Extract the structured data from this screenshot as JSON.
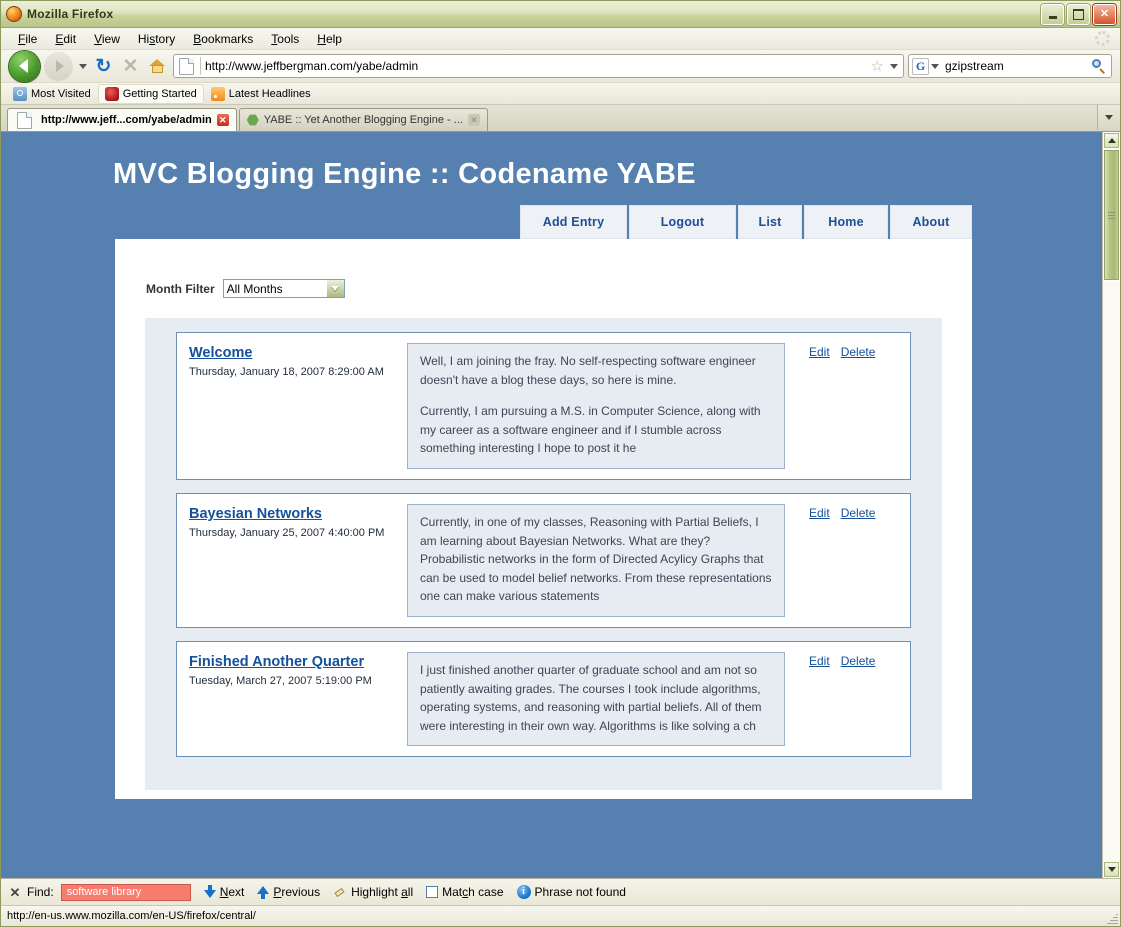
{
  "window": {
    "title": "Mozilla Firefox",
    "minimize_label": "Minimize",
    "maximize_label": "Maximize",
    "close_label": "Close"
  },
  "menubar": {
    "items": [
      "File",
      "Edit",
      "View",
      "History",
      "Bookmarks",
      "Tools",
      "Help"
    ]
  },
  "toolbar": {
    "back_label": "Back",
    "forward_label": "Forward",
    "reload_glyph": "⟳",
    "stop_glyph": "✕",
    "home_label": "Home",
    "url": "http://www.jeffbergman.com/yabe/admin",
    "star_glyph": "☆",
    "search_engine": "G",
    "search_value": "gzipstream",
    "search_placeholder": "Search"
  },
  "bookmarks": {
    "items": [
      {
        "label": "Most Visited",
        "icon": "most-visited-icon"
      },
      {
        "label": "Getting Started",
        "icon": "getting-started-icon"
      },
      {
        "label": "Latest Headlines",
        "icon": "rss-icon"
      }
    ]
  },
  "tabs": {
    "items": [
      {
        "label": "http://www.jeff...com/yabe/admin",
        "active": true
      },
      {
        "label": "YABE :: Yet Another Blogging Engine - ...",
        "active": false
      }
    ],
    "list_all_label": "List all tabs"
  },
  "page": {
    "site_title": "MVC Blogging Engine :: Codename YABE",
    "nav": [
      {
        "label": "Add Entry"
      },
      {
        "label": "Logout"
      },
      {
        "label": "List"
      },
      {
        "label": "Home"
      },
      {
        "label": "About"
      }
    ],
    "filter": {
      "label": "Month Filter",
      "value": "All Months"
    },
    "actions": {
      "edit": "Edit",
      "delete": "Delete"
    },
    "entries": [
      {
        "title": "Welcome",
        "date": "Thursday, January 18, 2007 8:29:00 AM",
        "paragraphs": [
          "Well, I am joining the fray.  No self-respecting software engineer doesn't have a blog these days, so here is mine.",
          "Currently, I am pursuing a M.S. in Computer Science, along with my career as a software engineer and if I stumble across something interesting I hope to post it he"
        ]
      },
      {
        "title": "Bayesian Networks",
        "date": "Thursday, January 25, 2007 4:40:00 PM",
        "paragraphs": [
          "Currently, in one of my classes,  Reasoning with Partial Beliefs, I am learning about Bayesian Networks.  What are they? Probabilistic networks in the form of Directed Acylicy Graphs that can be used to model belief networks.  From these representations one can make various statements"
        ]
      },
      {
        "title": "Finished Another Quarter",
        "date": "Tuesday, March 27, 2007 5:19:00 PM",
        "paragraphs": [
          "I just finished another quarter of graduate school and am not so patiently awaiting grades.  The courses I took include algorithms, operating systems, and reasoning with partial beliefs.   All of them were interesting in their own way.  Algorithms  is  like solving a ch"
        ]
      }
    ]
  },
  "findbar": {
    "close_glyph": "✕",
    "label": "Find:",
    "value": "software library",
    "next": "Next",
    "previous": "Previous",
    "highlight_all": "Highlight all",
    "match_case": "Match case",
    "status": "Phrase not found"
  },
  "statusbar": {
    "text": "http://en-us.www.mozilla.com/en-US/firefox/central/"
  },
  "colors": {
    "page_background": "#5580b0",
    "title_link": "#14509b",
    "nav_button_bg": "#eef2f7",
    "entry_body_bg": "#e7ecf3",
    "find_notfound_bg": "#f87c6e"
  }
}
